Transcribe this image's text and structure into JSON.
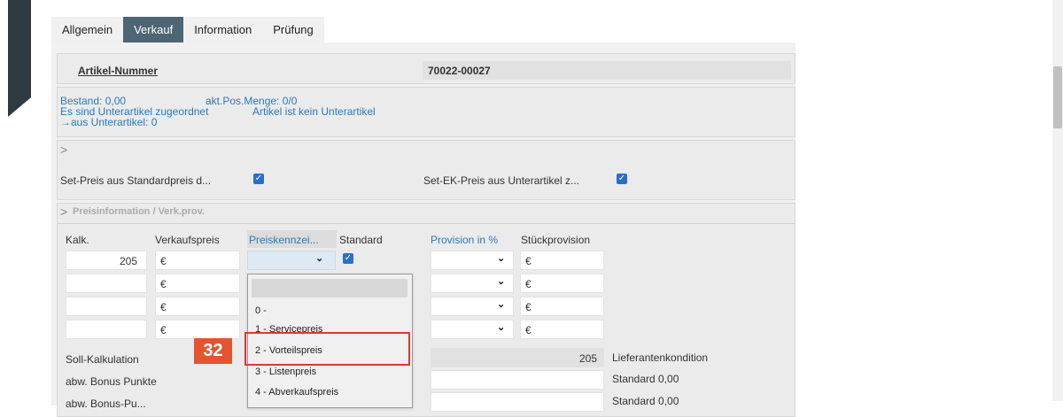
{
  "tabs": [
    "Allgemein",
    "Verkauf",
    "Information",
    "Prüfung"
  ],
  "active_tab": "Verkauf",
  "article": {
    "label": "Artikel-Nummer",
    "value": "70022-00027"
  },
  "info": {
    "bestand": "Bestand: 0,00",
    "akt_pos": "akt.Pos.Menge: 0/0",
    "unterartikel": "Es sind Unterartikel zugeordnet",
    "kein_unterartikel": "Artikel ist kein Unterartikel",
    "aus_unterartikel": "→aus Unterartikel: 0"
  },
  "expand_glyph": ">",
  "set_preis": {
    "label": "Set-Preis aus Standardpreis d...",
    "checked": true
  },
  "set_ek": {
    "label": "Set-EK-Preis aus Unterartikel z...",
    "checked": true
  },
  "section": {
    "title": "Preisinformation / Verk.prov."
  },
  "columns": {
    "kalk": "Kalk.",
    "verkaufspreis": "Verkaufspreis",
    "preiskennzeichen": "Preiskennzei...",
    "standard": "Standard",
    "provision": "Provision in %",
    "stueckprovision": "Stückprovision"
  },
  "rows": [
    {
      "kalk": "205",
      "currency": "€",
      "currency2": "€"
    },
    {
      "kalk": "",
      "currency": "€",
      "currency2": "€"
    },
    {
      "kalk": "",
      "currency": "€",
      "currency2": "€"
    },
    {
      "kalk": "",
      "currency": "€",
      "currency2": "€"
    }
  ],
  "chevron": "⌄",
  "labels": {
    "soll": "Soll-Kalkulation",
    "bonus": "abw. Bonus Punkte",
    "bonus2": "abw. Bonus-Pu...",
    "soll_value": "205",
    "lieferant": "Lieferantenkondition",
    "standard1": "Standard 0,00",
    "standard2": "Standard 0,00"
  },
  "dropdown": {
    "options": [
      "",
      "0 -",
      "1 - Servicepreis",
      "2 - Vorteilspreis",
      "3 - Listenpreis",
      "4 - Abverkaufspreis"
    ],
    "highlighted": "2 - Vorteilspreis"
  },
  "step_badge": "32",
  "colors": {
    "accent": "#4e6573",
    "link": "#2a7ab9",
    "badge": "#e2552f",
    "highlight": "#d83a2c"
  }
}
